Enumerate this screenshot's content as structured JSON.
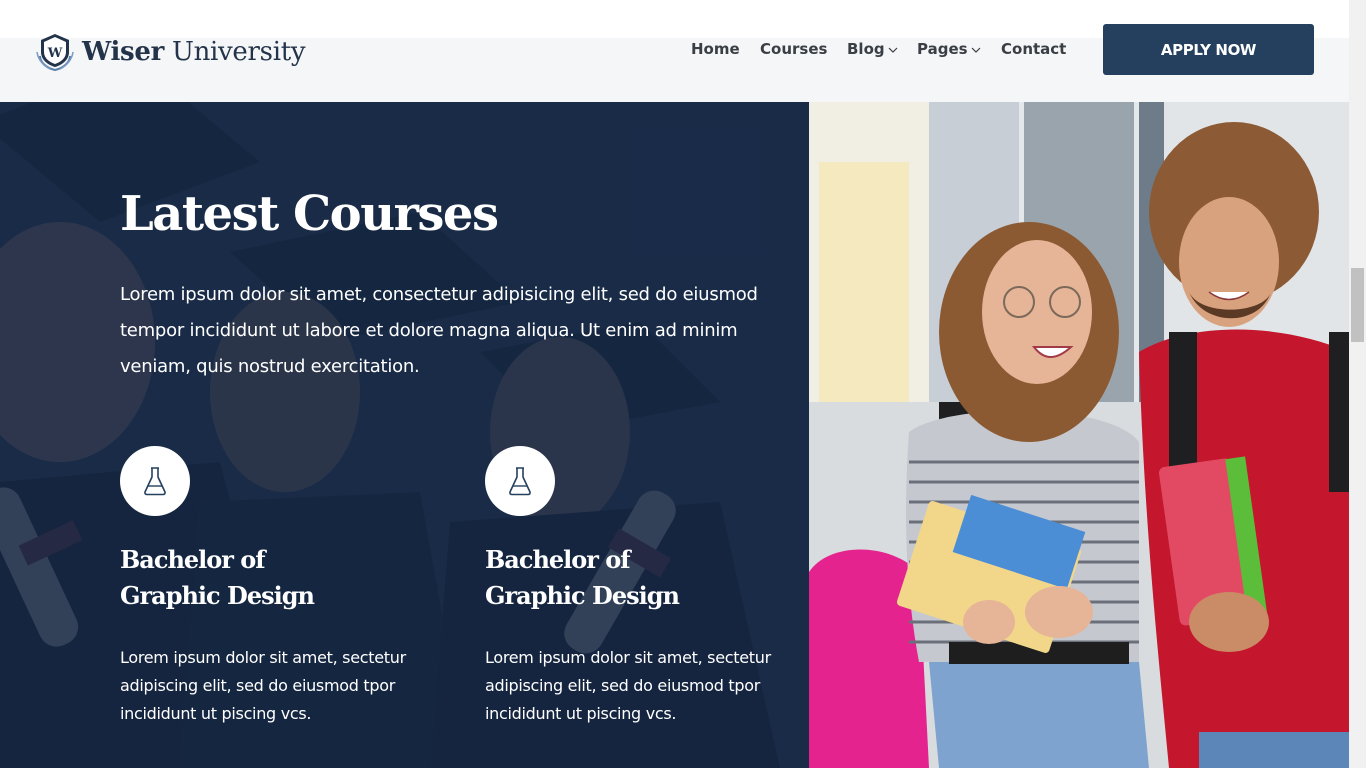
{
  "brand": {
    "name_strong": "Wiser",
    "name_light": "University",
    "logo_icon": "shield-w-icon"
  },
  "nav": {
    "items": [
      {
        "label": "Home",
        "has_dropdown": false
      },
      {
        "label": "Courses",
        "has_dropdown": false
      },
      {
        "label": "Blog",
        "has_dropdown": true
      },
      {
        "label": "Pages",
        "has_dropdown": true
      },
      {
        "label": "Contact",
        "has_dropdown": false
      }
    ],
    "cta_label": "APPLY NOW"
  },
  "hero": {
    "title": "Latest Courses",
    "description": "Lorem ipsum dolor sit amet, consectetur adipisicing elit, sed do eiusmod tempor incididunt ut labore et dolore magna aliqua. Ut enim ad minim veniam, quis nostrud exercitation.",
    "courses": [
      {
        "icon": "flask-icon",
        "title_line1": "Bachelor of",
        "title_line2": "Graphic Design",
        "description": "Lorem ipsum dolor sit amet, sectetur adipiscing elit, sed do eiusmod tpor incididunt ut piscing vcs."
      },
      {
        "icon": "flask-icon",
        "title_line1": "Bachelor of",
        "title_line2": "Graphic Design",
        "description": "Lorem ipsum dolor sit amet, sectetur adipiscing elit, sed do eiusmod tpor incididunt ut piscing vcs."
      }
    ]
  },
  "colors": {
    "primary": "#25405f",
    "overlay": "#162946",
    "nav_text": "#3a3f45",
    "white": "#ffffff"
  }
}
